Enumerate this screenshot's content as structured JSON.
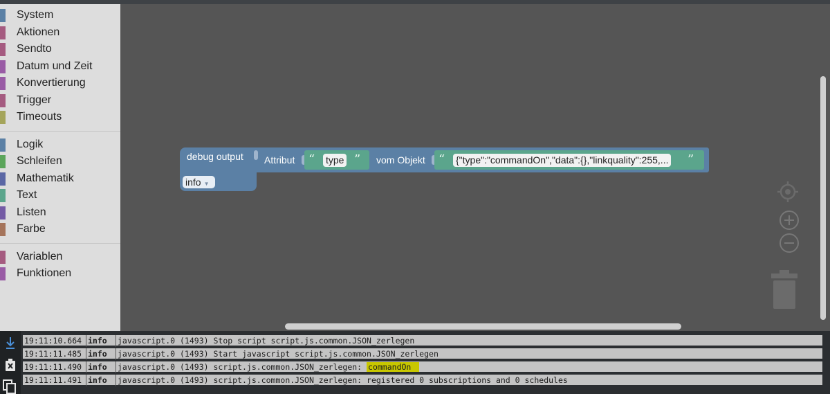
{
  "toolbox": {
    "groups": [
      [
        {
          "label": "System",
          "color": "#5b80a5"
        },
        {
          "label": "Aktionen",
          "color": "#a55b80"
        },
        {
          "label": "Sendto",
          "color": "#a55b80"
        },
        {
          "label": "Datum und Zeit",
          "color": "#995ba5"
        },
        {
          "label": "Konvertierung",
          "color": "#995ba5"
        },
        {
          "label": "Trigger",
          "color": "#a55b80"
        },
        {
          "label": "Timeouts",
          "color": "#a5a55b"
        }
      ],
      [
        {
          "label": "Logik",
          "color": "#5b80a5"
        },
        {
          "label": "Schleifen",
          "color": "#5ba55b"
        },
        {
          "label": "Mathematik",
          "color": "#5b67a5"
        },
        {
          "label": "Text",
          "color": "#5ba58c"
        },
        {
          "label": "Listen",
          "color": "#745ba5"
        },
        {
          "label": "Farbe",
          "color": "#a5745b"
        }
      ],
      [
        {
          "label": "Variablen",
          "color": "#a55b80"
        },
        {
          "label": "Funktionen",
          "color": "#995ba5"
        }
      ]
    ]
  },
  "workspace": {
    "debug_block": {
      "title": "debug output",
      "level": "info"
    },
    "attr_block": {
      "prefix": "Attribut",
      "attr_value": "type",
      "mid": "vom Objekt",
      "object_value": "{\"type\":\"commandOn\",\"data\":{},\"linkquality\":255,..."
    },
    "quote_open": "“",
    "quote_close": "”"
  },
  "controls": [
    "recenter-icon",
    "zoom-in-icon",
    "zoom-out-icon",
    "trash-icon"
  ],
  "log": {
    "side_icons": [
      "scroll-down-icon",
      "clear-log-icon",
      "copy-log-icon"
    ],
    "rows": [
      {
        "time": "19:11:10.664",
        "severity": "info",
        "message": "javascript.0 (1493) Stop script script.js.common.JSON_zerlegen",
        "highlight": ""
      },
      {
        "time": "19:11:11.485",
        "severity": "info",
        "message": "javascript.0 (1493) Start javascript script.js.common.JSON_zerlegen",
        "highlight": ""
      },
      {
        "time": "19:11:11.490",
        "severity": "info",
        "message": "javascript.0 (1493) script.js.common.JSON_zerlegen: ",
        "highlight": "commandOn"
      },
      {
        "time": "19:11:11.491",
        "severity": "info",
        "message": "javascript.0 (1493) script.js.common.JSON_zerlegen: registered 0 subscriptions and 0 schedules",
        "highlight": ""
      }
    ]
  }
}
